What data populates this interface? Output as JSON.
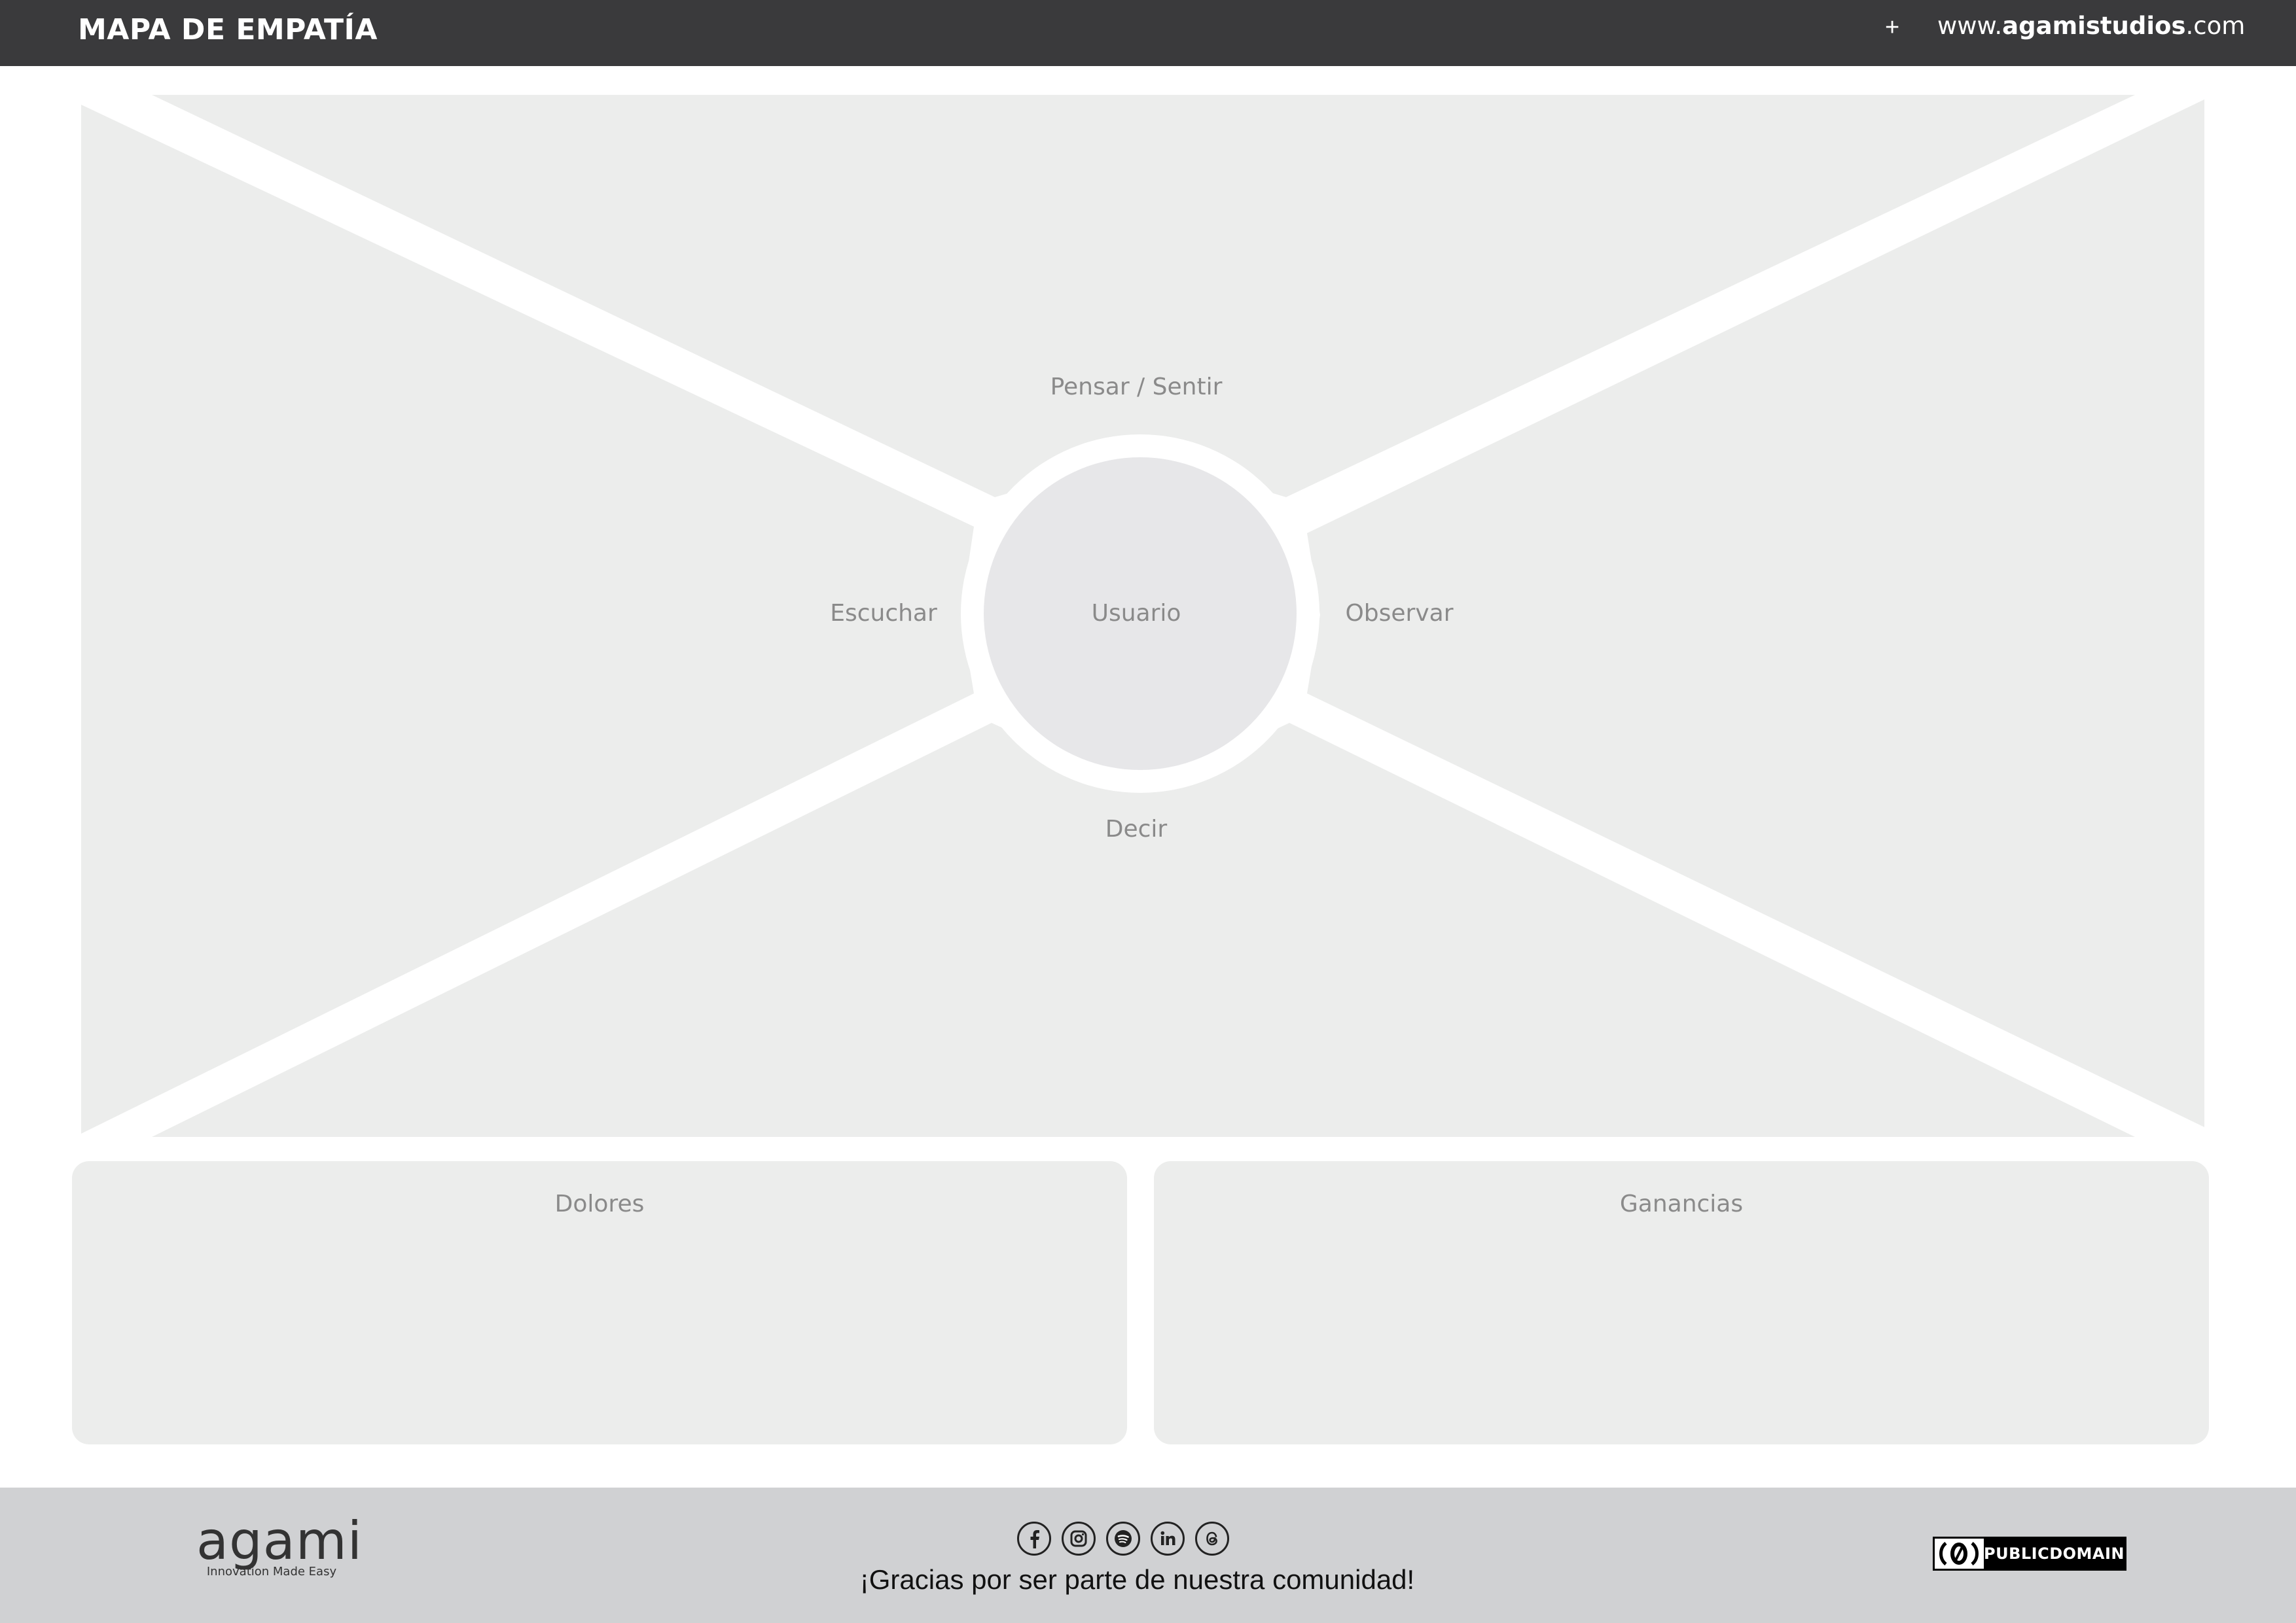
{
  "header": {
    "title": "MAPA DE EMPATÍA",
    "plus": "+",
    "website_prefix": "www.",
    "website_bold": "agamistudios",
    "website_suffix": ".com"
  },
  "map": {
    "center": "Usuario",
    "top": "Pensar / Sentir",
    "left": "Escuchar",
    "right": "Observar",
    "bottom": "Decir"
  },
  "panels": {
    "left": "Dolores",
    "right": "Ganancias"
  },
  "footer": {
    "brand_name": "agami",
    "brand_tagline": "Innovation Made Easy",
    "social_icons": [
      "facebook-icon",
      "instagram-icon",
      "spotify-icon",
      "linkedin-icon",
      "threads-icon"
    ],
    "thanks": "¡Gracias por ser parte de nuestra comunidad!",
    "license_text": "PUBLICDOMAIN"
  },
  "colors": {
    "header_bg": "#3a3a3c",
    "zone_fill": "#ecedec",
    "hub_fill": "#e7e7e9",
    "footer_bg": "#d0d1d3",
    "label_text": "#8a8a8a"
  }
}
